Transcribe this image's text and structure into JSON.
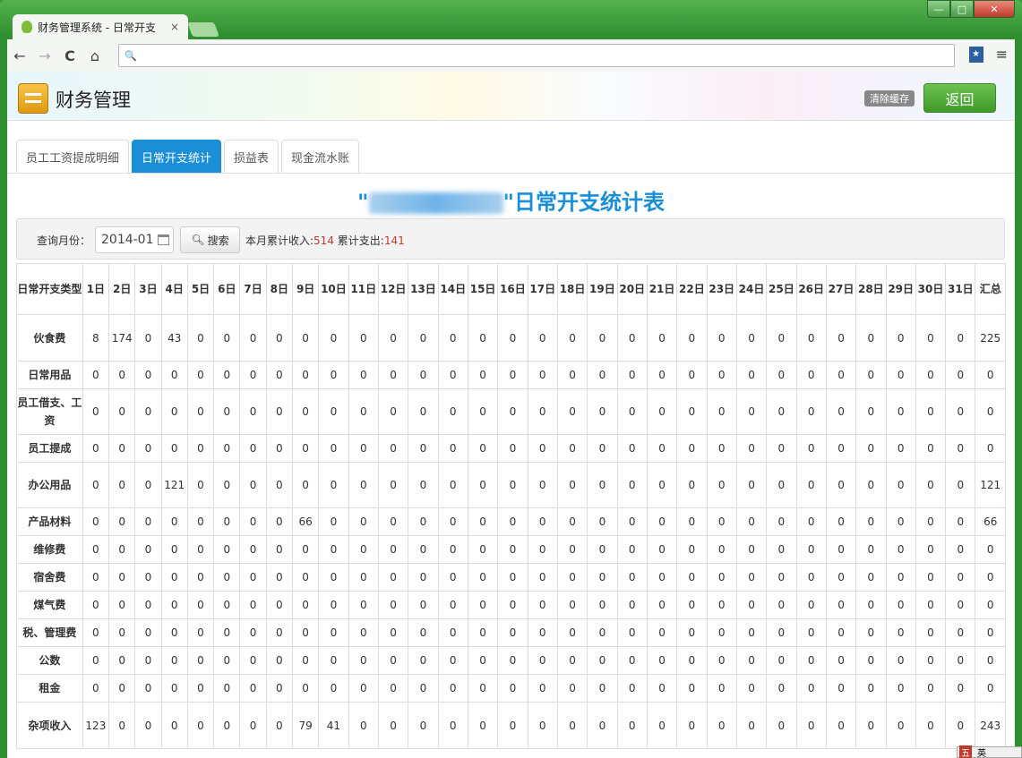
{
  "browser": {
    "tab_title": "财务管理系统 - 日常开支",
    "tab_close": "×",
    "nav_back": "←",
    "nav_forward": "→",
    "nav_reload": "C",
    "nav_home": "⌂",
    "search_icon": "🔍",
    "bookmark": "★",
    "menu_icon": "≡",
    "win_min": "—",
    "win_max": "□",
    "win_close": "✕"
  },
  "header": {
    "title": "财务管理",
    "clear_cache": "清除缓存",
    "back": "返回"
  },
  "tabs": [
    "员工工资提成明细",
    "日常开支统计",
    "损益表",
    "现金流水账"
  ],
  "active_tab": 1,
  "report": {
    "title_open": "\"",
    "title_close": "\"日常开支统计表"
  },
  "query": {
    "label": "查询月份：",
    "month": "2014-01",
    "search": "搜索",
    "income_label": "本月累计收入:",
    "income": "514",
    "expense_label": " 累计支出:",
    "expense": "141"
  },
  "table": {
    "type_header": "日常开支类型",
    "day_headers": [
      "1日",
      "2日",
      "3日",
      "4日",
      "5日",
      "6日",
      "7日",
      "8日",
      "9日",
      "10日",
      "11日",
      "12日",
      "13日",
      "14日",
      "15日",
      "16日",
      "17日",
      "18日",
      "19日",
      "20日",
      "21日",
      "22日",
      "23日",
      "24日",
      "25日",
      "26日",
      "27日",
      "28日",
      "29日",
      "30日",
      "31日"
    ],
    "total_header": "汇总",
    "rows": [
      {
        "category": "伙食费",
        "values": [
          "8",
          "174",
          "0",
          "43",
          "0",
          "0",
          "0",
          "0",
          "0",
          "0",
          "0",
          "0",
          "0",
          "0",
          "0",
          "0",
          "0",
          "0",
          "0",
          "0",
          "0",
          "0",
          "0",
          "0",
          "0",
          "0",
          "0",
          "0",
          "0",
          "0",
          "0"
        ],
        "total": "225"
      },
      {
        "category": "日常用品",
        "values": [
          "0",
          "0",
          "0",
          "0",
          "0",
          "0",
          "0",
          "0",
          "0",
          "0",
          "0",
          "0",
          "0",
          "0",
          "0",
          "0",
          "0",
          "0",
          "0",
          "0",
          "0",
          "0",
          "0",
          "0",
          "0",
          "0",
          "0",
          "0",
          "0",
          "0",
          "0"
        ],
        "total": "0"
      },
      {
        "category": "员工借支、工资",
        "values": [
          "0",
          "0",
          "0",
          "0",
          "0",
          "0",
          "0",
          "0",
          "0",
          "0",
          "0",
          "0",
          "0",
          "0",
          "0",
          "0",
          "0",
          "0",
          "0",
          "0",
          "0",
          "0",
          "0",
          "0",
          "0",
          "0",
          "0",
          "0",
          "0",
          "0",
          "0"
        ],
        "total": "0"
      },
      {
        "category": "员工提成",
        "values": [
          "0",
          "0",
          "0",
          "0",
          "0",
          "0",
          "0",
          "0",
          "0",
          "0",
          "0",
          "0",
          "0",
          "0",
          "0",
          "0",
          "0",
          "0",
          "0",
          "0",
          "0",
          "0",
          "0",
          "0",
          "0",
          "0",
          "0",
          "0",
          "0",
          "0",
          "0"
        ],
        "total": "0"
      },
      {
        "category": "办公用品",
        "values": [
          "0",
          "0",
          "0",
          "121",
          "0",
          "0",
          "0",
          "0",
          "0",
          "0",
          "0",
          "0",
          "0",
          "0",
          "0",
          "0",
          "0",
          "0",
          "0",
          "0",
          "0",
          "0",
          "0",
          "0",
          "0",
          "0",
          "0",
          "0",
          "0",
          "0",
          "0"
        ],
        "total": "121"
      },
      {
        "category": "产品材料",
        "values": [
          "0",
          "0",
          "0",
          "0",
          "0",
          "0",
          "0",
          "0",
          "66",
          "0",
          "0",
          "0",
          "0",
          "0",
          "0",
          "0",
          "0",
          "0",
          "0",
          "0",
          "0",
          "0",
          "0",
          "0",
          "0",
          "0",
          "0",
          "0",
          "0",
          "0",
          "0"
        ],
        "total": "66"
      },
      {
        "category": "维修费",
        "values": [
          "0",
          "0",
          "0",
          "0",
          "0",
          "0",
          "0",
          "0",
          "0",
          "0",
          "0",
          "0",
          "0",
          "0",
          "0",
          "0",
          "0",
          "0",
          "0",
          "0",
          "0",
          "0",
          "0",
          "0",
          "0",
          "0",
          "0",
          "0",
          "0",
          "0",
          "0"
        ],
        "total": "0"
      },
      {
        "category": "宿舍费",
        "values": [
          "0",
          "0",
          "0",
          "0",
          "0",
          "0",
          "0",
          "0",
          "0",
          "0",
          "0",
          "0",
          "0",
          "0",
          "0",
          "0",
          "0",
          "0",
          "0",
          "0",
          "0",
          "0",
          "0",
          "0",
          "0",
          "0",
          "0",
          "0",
          "0",
          "0",
          "0"
        ],
        "total": "0"
      },
      {
        "category": "煤气费",
        "values": [
          "0",
          "0",
          "0",
          "0",
          "0",
          "0",
          "0",
          "0",
          "0",
          "0",
          "0",
          "0",
          "0",
          "0",
          "0",
          "0",
          "0",
          "0",
          "0",
          "0",
          "0",
          "0",
          "0",
          "0",
          "0",
          "0",
          "0",
          "0",
          "0",
          "0",
          "0"
        ],
        "total": "0"
      },
      {
        "category": "税、管理费",
        "values": [
          "0",
          "0",
          "0",
          "0",
          "0",
          "0",
          "0",
          "0",
          "0",
          "0",
          "0",
          "0",
          "0",
          "0",
          "0",
          "0",
          "0",
          "0",
          "0",
          "0",
          "0",
          "0",
          "0",
          "0",
          "0",
          "0",
          "0",
          "0",
          "0",
          "0",
          "0"
        ],
        "total": "0"
      },
      {
        "category": "公数",
        "values": [
          "0",
          "0",
          "0",
          "0",
          "0",
          "0",
          "0",
          "0",
          "0",
          "0",
          "0",
          "0",
          "0",
          "0",
          "0",
          "0",
          "0",
          "0",
          "0",
          "0",
          "0",
          "0",
          "0",
          "0",
          "0",
          "0",
          "0",
          "0",
          "0",
          "0",
          "0"
        ],
        "total": "0"
      },
      {
        "category": "租金",
        "values": [
          "0",
          "0",
          "0",
          "0",
          "0",
          "0",
          "0",
          "0",
          "0",
          "0",
          "0",
          "0",
          "0",
          "0",
          "0",
          "0",
          "0",
          "0",
          "0",
          "0",
          "0",
          "0",
          "0",
          "0",
          "0",
          "0",
          "0",
          "0",
          "0",
          "0",
          "0"
        ],
        "total": "0"
      },
      {
        "category": "杂项收入",
        "values": [
          "123",
          "0",
          "0",
          "0",
          "0",
          "0",
          "0",
          "0",
          "79",
          "41",
          "0",
          "0",
          "0",
          "0",
          "0",
          "0",
          "0",
          "0",
          "0",
          "0",
          "0",
          "0",
          "0",
          "0",
          "0",
          "0",
          "0",
          "0",
          "0",
          "0",
          "0"
        ],
        "total": "243"
      }
    ]
  },
  "ime": {
    "icon": "五",
    "lang": "英"
  }
}
